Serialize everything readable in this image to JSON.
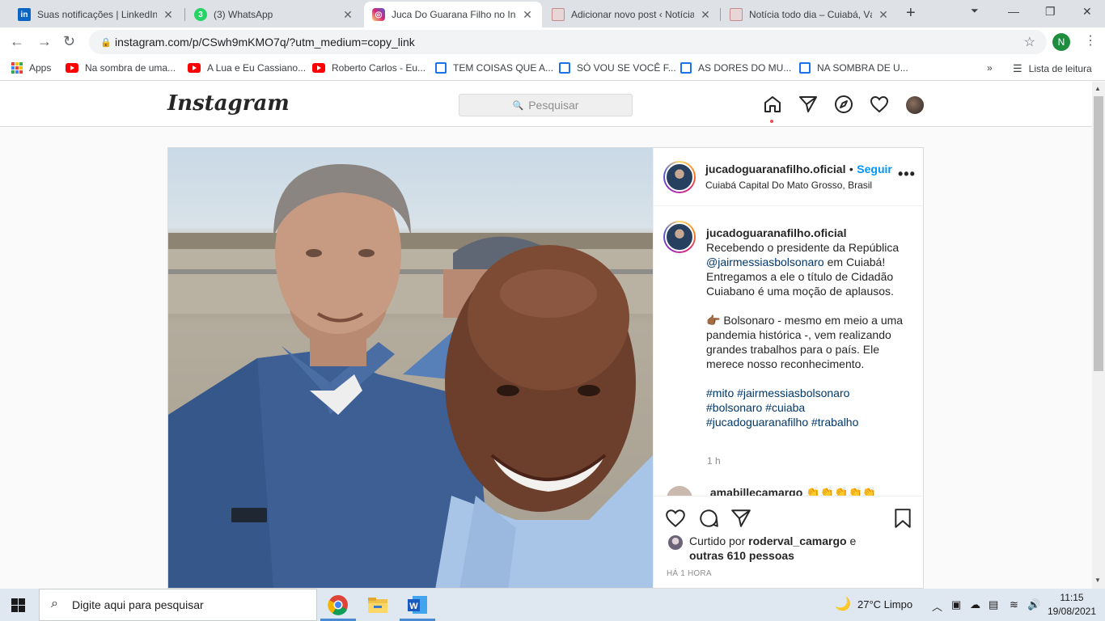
{
  "browser": {
    "tabs": [
      {
        "title": "Suas notificações | LinkedIn",
        "icon": "linkedin-icon",
        "active": false
      },
      {
        "title": "(3) WhatsApp",
        "icon": "whatsapp-icon",
        "badge": "3",
        "active": false
      },
      {
        "title": "Juca Do Guarana Filho no Instagram",
        "icon": "instagram-icon",
        "active": true
      },
      {
        "title": "Adicionar novo post ‹ Notícia todo dia",
        "icon": "page-icon",
        "active": false
      },
      {
        "title": "Notícia todo dia – Cuiabá, Várzea Grande",
        "icon": "page-icon",
        "active": false
      }
    ],
    "url": "instagram.com/p/CSwh9mKMO7q/?utm_medium=copy_link",
    "profile_initial": "N",
    "bookmarks": [
      {
        "label": "Apps",
        "icon": "apps-icon"
      },
      {
        "label": "Na sombra de uma...",
        "icon": "youtube-icon"
      },
      {
        "label": "A Lua e Eu Cassiano...",
        "icon": "youtube-icon"
      },
      {
        "label": "Roberto Carlos - Eu...",
        "icon": "youtube-icon"
      },
      {
        "label": "TEM COISAS QUE A...",
        "icon": "doc-icon"
      },
      {
        "label": "SÓ VOU SE VOCÊ F...",
        "icon": "doc-icon"
      },
      {
        "label": "AS DORES DO MU...",
        "icon": "doc-icon"
      },
      {
        "label": "NA SOMBRA DE U...",
        "icon": "doc-icon"
      }
    ],
    "more_bookmarks": "»",
    "reading_list": "Lista de leitura"
  },
  "instagram": {
    "logo": "Instagram",
    "search_placeholder": "Pesquisar",
    "post": {
      "username": "jucadoguaranafilho.oficial",
      "separator": "•",
      "follow_label": "Seguir",
      "location": "Cuiabá Capital Do Mato Grosso, Brasil",
      "caption_intro": "Recebendo o presidente da República",
      "caption_mention": "@jairmessiasbolsonaro",
      "caption_rest": "em Cuiabá! Entregamos a ele o título de Cidadão Cuiabano é uma moção de aplausos.",
      "caption_p2": "👉🏾 Bolsonaro - mesmo em meio a uma pandemia histórica -, vem realizando grandes trabalhos para o país. Ele merece nosso reconhecimento.",
      "hashtags": [
        "#mito",
        "#jairmessiasbolsonaro",
        "#bolsonaro",
        "#cuiaba",
        "#jucadoguaranafilho",
        "#trabalho"
      ],
      "time": "1 h",
      "comment_user": "amabillecamargo",
      "comment_text": "👏👏👏👏👏",
      "liked_by_prefix": "Curtido por",
      "liked_by_user": "roderval_camargo",
      "liked_by_and": "e",
      "liked_by_others": "outras 610 pessoas",
      "posted_ago": "HÁ 1 HORA"
    }
  },
  "taskbar": {
    "search_placeholder": "Digite aqui para pesquisar",
    "weather": "27°C  Limpo",
    "time": "11:15",
    "date": "19/08/2021"
  },
  "colors": {
    "instagram_blue": "#0095f6",
    "link_dark": "#00376b",
    "notification_red": "#ed4956"
  }
}
